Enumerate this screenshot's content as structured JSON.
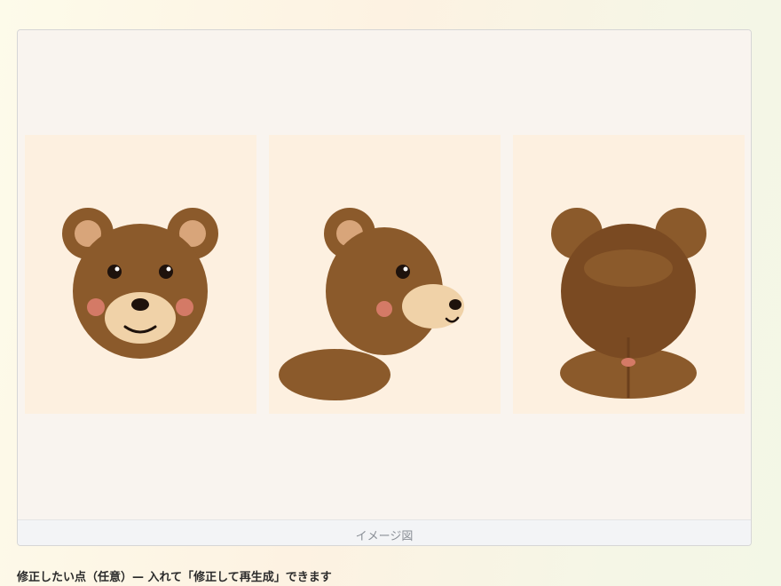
{
  "preview": {
    "caption": "イメージ図",
    "images": [
      {
        "name": "bear-front-view"
      },
      {
        "name": "bear-side-view"
      },
      {
        "name": "bear-back-view"
      }
    ]
  },
  "hint": {
    "text": "修正したい点（任意）— 入れて「修正して再生成」できます"
  },
  "colors": {
    "fur": "#8b5a2b",
    "fur_dark": "#7a4a22",
    "inner_ear": "#d8a57a",
    "muzzle": "#f0d2a8",
    "cheek": "#d47a66",
    "eye": "#1e120c",
    "panel_bg": "#fdf0e0"
  }
}
